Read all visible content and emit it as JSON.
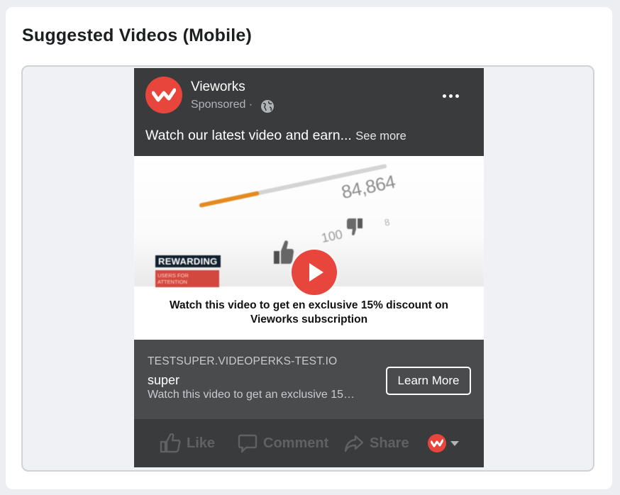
{
  "section": {
    "title": "Suggested Videos (Mobile)"
  },
  "post": {
    "page_name": "Vieworks",
    "sponsored_label": "Sponsored",
    "separator": "·",
    "caption": "Watch our latest video and earn...",
    "see_more": "See more",
    "icons": {
      "avatar": "vieworks-logo-icon",
      "privacy": "globe-icon",
      "menu": "more-options-icon"
    }
  },
  "media": {
    "view_count": "84,864",
    "like_count": "100",
    "dislike_count": "8",
    "progress_fraction": 0.32,
    "badge_title": "REWARDING",
    "badge_subtitle": "USERS FOR ATTENTION",
    "overlay_text": "Watch this video to get en exclusive 15% discount on Vieworks subscription",
    "play_icon": "play-icon"
  },
  "cta": {
    "domain": "TESTSUPER.VIDEOPERKS-TEST.IO",
    "title": "super",
    "description": "Watch this video to get an exclusive 15…",
    "button_label": "Learn More"
  },
  "actions": {
    "like": "Like",
    "comment": "Comment",
    "share": "Share",
    "icons": [
      "like-icon",
      "comment-icon",
      "share-icon",
      "chevron-down-icon"
    ]
  },
  "colors": {
    "brand": "#e8453c",
    "post_bg": "#3a3b3c",
    "cta_bg": "#4a4b4d",
    "progress": "#e58a1f"
  }
}
